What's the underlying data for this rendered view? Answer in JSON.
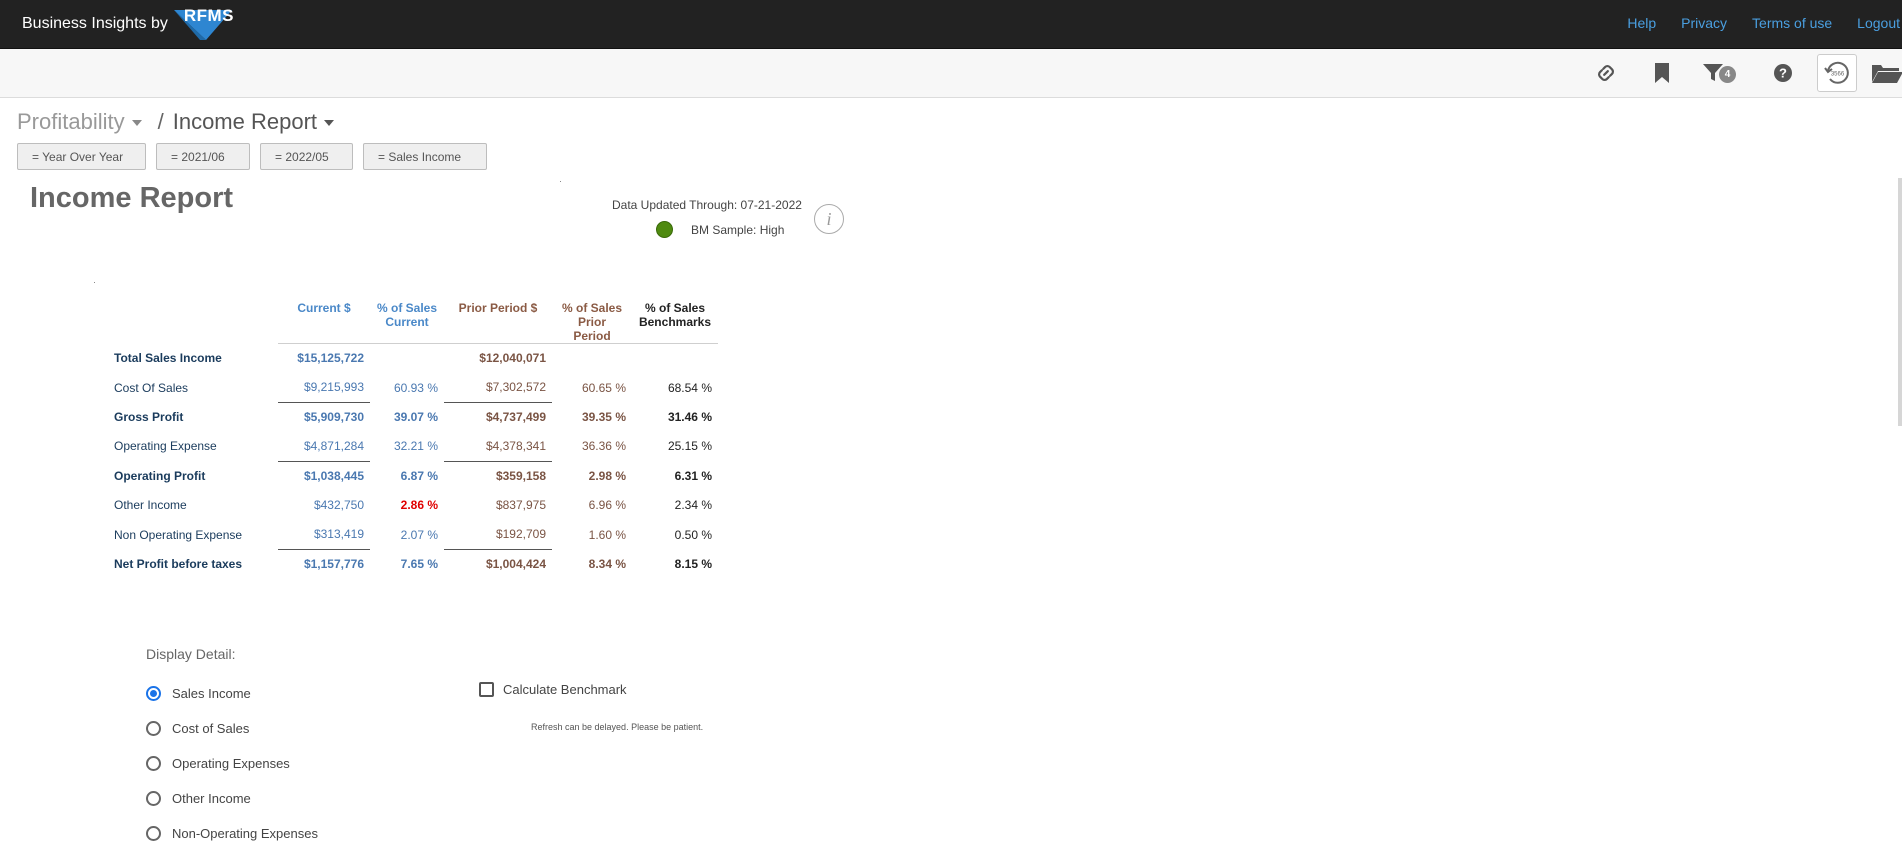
{
  "brand": {
    "prefix": "Business Insights by",
    "logo_text": "RFMS"
  },
  "nav": {
    "help": "Help",
    "privacy": "Privacy",
    "terms": "Terms of use",
    "logout": "Logout"
  },
  "toolbar": {
    "filter_count": "4",
    "history_label": "3566"
  },
  "breadcrumb": {
    "parent": "Profitability",
    "separator": "/",
    "current": "Income Report"
  },
  "filters": [
    "= Year Over Year",
    "= 2021/06",
    "= 2022/05",
    "= Sales Income"
  ],
  "report": {
    "title": "Income Report",
    "updated": "Data Updated Through: 07-21-2022",
    "bm_sample": "BM Sample: High",
    "info_glyph": "i"
  },
  "table": {
    "headers": {
      "current": "Current $",
      "pct_current_1": "% of Sales",
      "pct_current_2": "Current",
      "prior": "Prior Period $",
      "pct_prior_1": "% of Sales",
      "pct_prior_2": "Prior Period",
      "bench_1": "% of Sales",
      "bench_2": "Benchmarks"
    },
    "rows": [
      {
        "label": "Total Sales Income",
        "current": "$15,125,722",
        "pct_current": "",
        "prior": "$12,040,071",
        "pct_prior": "",
        "bench": ""
      },
      {
        "label": "Cost Of Sales",
        "current": "$9,215,993",
        "pct_current": "60.93 %",
        "prior": "$7,302,572",
        "pct_prior": "60.65 %",
        "bench": "68.54 %"
      },
      {
        "label": "Gross Profit",
        "current": "$5,909,730",
        "pct_current": "39.07 %",
        "prior": "$4,737,499",
        "pct_prior": "39.35 %",
        "bench": "31.46 %"
      },
      {
        "label": "Operating Expense",
        "current": "$4,871,284",
        "pct_current": "32.21 %",
        "prior": "$4,378,341",
        "pct_prior": "36.36 %",
        "bench": "25.15 %"
      },
      {
        "label": "Operating Profit",
        "current": "$1,038,445",
        "pct_current": "6.87 %",
        "prior": "$359,158",
        "pct_prior": "2.98 %",
        "bench": "6.31 %"
      },
      {
        "label": "Other Income",
        "current": "$432,750",
        "pct_current": "2.86 %",
        "prior": "$837,975",
        "pct_prior": "6.96 %",
        "bench": "2.34 %"
      },
      {
        "label": "Non Operating Expense",
        "current": "$313,419",
        "pct_current": "2.07 %",
        "prior": "$192,709",
        "pct_prior": "1.60 %",
        "bench": "0.50 %"
      },
      {
        "label": "Net Profit before taxes",
        "current": "$1,157,776",
        "pct_current": "7.65 %",
        "prior": "$1,004,424",
        "pct_prior": "8.34 %",
        "bench": "8.15 %"
      }
    ]
  },
  "display_detail": {
    "label": "Display Detail:",
    "options": [
      "Sales Income",
      "Cost of Sales",
      "Operating Expenses",
      "Other Income",
      "Non-Operating Expenses"
    ],
    "selected": "Sales Income"
  },
  "benchmark": {
    "label": "Calculate Benchmark",
    "note": "Refresh can be delayed.  Please be patient."
  },
  "colors": {
    "topbar": "#222222",
    "link": "#4a9fe0",
    "current": "#4a78b0",
    "prior": "#7a5444",
    "negative": "#e00000",
    "bm_dot": "#4f8a10",
    "radio_selected": "#1a73e8"
  }
}
